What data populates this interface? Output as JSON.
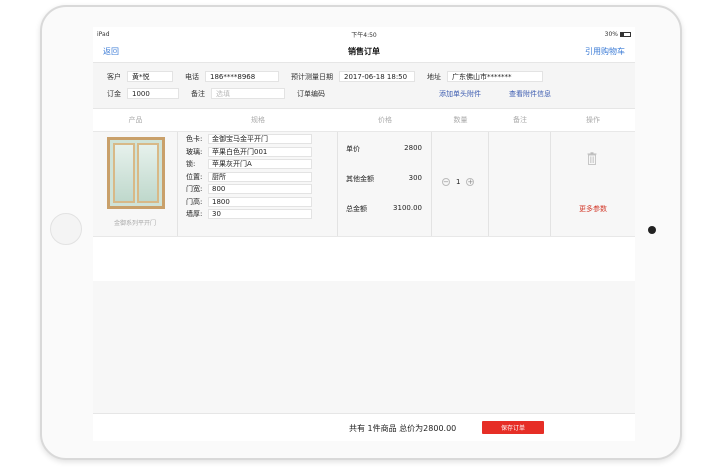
{
  "status": {
    "device": "iPad",
    "time": "下午4:50",
    "battery": "30%"
  },
  "nav": {
    "back": "返回",
    "title": "销售订单",
    "cart": "引用购物车"
  },
  "form": {
    "customer_label": "客户",
    "customer": "黄*悦",
    "phone_label": "电话",
    "phone": "186****8968",
    "measure_label": "预计测量日期",
    "measure_date": "2017-06-18 18:50",
    "address_label": "地址",
    "address": "广东佛山市*******",
    "deposit_label": "订金",
    "deposit": "1000",
    "remark_label": "备注",
    "remark_placeholder": "选填",
    "order_code_label": "订单编码",
    "add_attachment": "添加单头附件",
    "view_attachment": "查看附件信息"
  },
  "table": {
    "headers": [
      "产品",
      "规格",
      "价格",
      "数量",
      "备注",
      "操作"
    ],
    "row": {
      "product_name": "金御系列平开门",
      "specs": [
        {
          "key": "色卡:",
          "value": "金御宝马金平开门"
        },
        {
          "key": "玻璃:",
          "value": "苹果白色开门001"
        },
        {
          "key": "锁:",
          "value": "苹果灰开门A"
        },
        {
          "key": "位置:",
          "value": "厨所"
        },
        {
          "key": "门宽:",
          "value": "800"
        },
        {
          "key": "门高:",
          "value": "1800"
        },
        {
          "key": "墙厚:",
          "value": "30"
        }
      ],
      "unit_price_label": "单价",
      "unit_price": "2800",
      "other_label": "其他金额",
      "other_amount": "300",
      "total_label": "总金额",
      "total": "3100.00",
      "qty_minus": "−",
      "qty": "1",
      "qty_plus": "+",
      "more_params": "更多参数"
    }
  },
  "footer": {
    "summary": "共有 1件商品  总价为2800.00",
    "save": "保存订单"
  },
  "colors": {
    "accent_blue": "#3b7bd6",
    "save_red": "#e62e26",
    "link_red": "#d33b2c"
  }
}
